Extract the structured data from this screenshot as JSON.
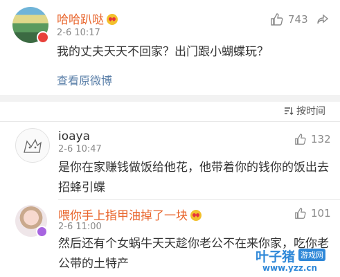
{
  "post": {
    "user": "哈哈趴哒",
    "time": "2-6 10:17",
    "likes": "743",
    "text": "我的丈夫天天不回家？出门跟小蝴蝶玩？",
    "view_original": "查看原微博"
  },
  "sort": {
    "label": "按时间"
  },
  "comments": [
    {
      "user": "ioaya",
      "time": "2-6 10:47",
      "likes": "132",
      "text_line1": "是你在家赚钱做饭给他花，他带着你的钱你的饭出去",
      "text_line2": "招蜂引蝶"
    },
    {
      "user": "喂你手上指甲油掉了一块",
      "time": "2-6 11:00",
      "likes": "101",
      "text_line1": "然后还有个女蜗牛天天趁你老公不在来你家，吃你老",
      "text_line2": "公带的土特产"
    }
  ],
  "watermark": {
    "brand": "叶子猪",
    "site": "游戏网",
    "url": "www.yzz.cn"
  },
  "colors": {
    "name_orange": "#e8642b",
    "link_blue": "#5a7fa8",
    "watermark_blue": "#2f88d8"
  }
}
